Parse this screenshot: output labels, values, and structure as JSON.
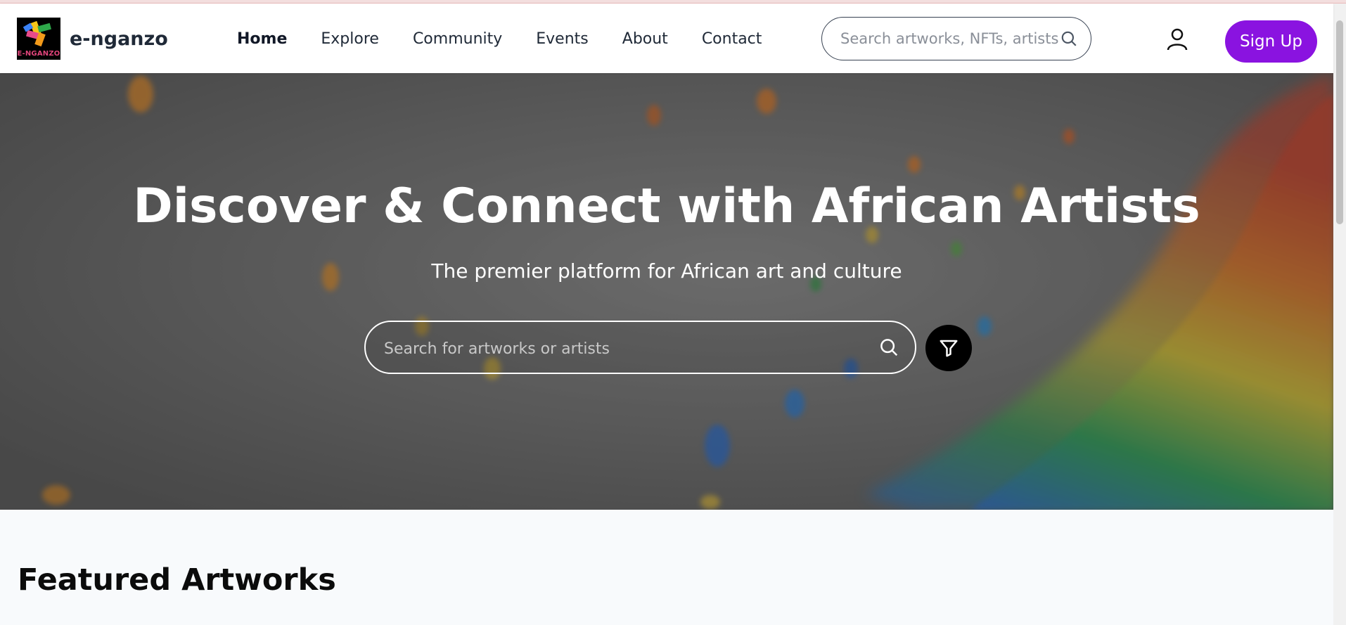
{
  "header": {
    "brand": "e-nganzo",
    "logo_text": "E-NGANZO",
    "nav": [
      {
        "label": "Home",
        "active": true
      },
      {
        "label": "Explore"
      },
      {
        "label": "Community"
      },
      {
        "label": "Events"
      },
      {
        "label": "About"
      },
      {
        "label": "Contact"
      }
    ],
    "search_placeholder": "Search artworks, NFTs, artists...",
    "signup_label": "Sign Up",
    "icons": [
      "search-icon",
      "user-icon"
    ]
  },
  "hero": {
    "title": "Discover & Connect with African Artists",
    "subtitle": "The premier platform for African art and culture",
    "search_placeholder": "Search for artworks or artists",
    "icons": [
      "search-icon",
      "filter-icon"
    ]
  },
  "featured": {
    "title": "Featured Artworks"
  },
  "colors": {
    "accent": "#8a13e0",
    "header_bg": "#ffffff",
    "page_bg": "#f8fafc"
  }
}
